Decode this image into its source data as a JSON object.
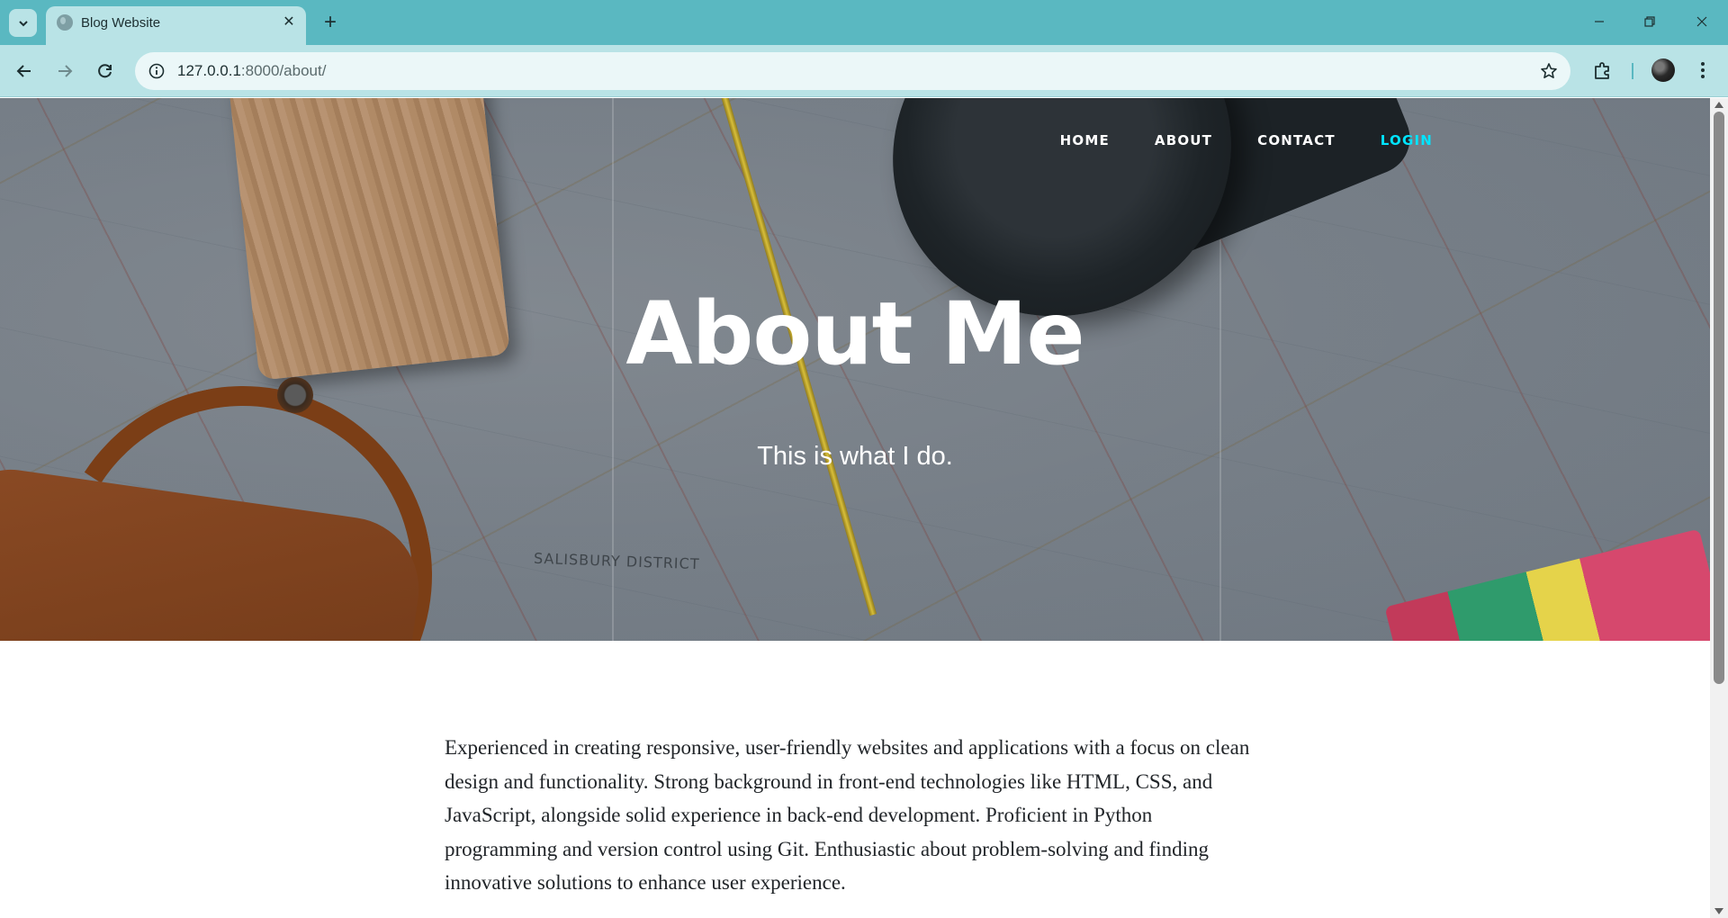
{
  "browser": {
    "tab_title": "Blog Website",
    "url_host": "127.0.0.1",
    "url_path": ":8000/about/"
  },
  "nav": {
    "items": [
      {
        "label": "HOME"
      },
      {
        "label": "ABOUT"
      },
      {
        "label": "CONTACT"
      },
      {
        "label": "LOGIN",
        "active": true
      }
    ]
  },
  "hero": {
    "title": "About Me",
    "subtitle": "This is what I do.",
    "map_label": "SALISBURY DISTRICT"
  },
  "content": {
    "paragraph": "Experienced in creating responsive, user-friendly websites and applications with a focus on clean design and functionality. Strong background in front-end technologies like HTML, CSS, and JavaScript, alongside solid experience in back-end development. Proficient in Python programming and version control using Git. Enthusiastic about problem-solving and finding innovative solutions to enhance user experience."
  },
  "colors": {
    "browser_frame": "#5ab8c1",
    "toolbar": "#b9e3e6",
    "active_nav": "#00e5ff",
    "body_text": "#212529"
  },
  "icons": {
    "tab_list": "chevron-down-icon",
    "favicon": "globe-icon",
    "tab_close": "close-icon",
    "new_tab": "plus-icon",
    "back": "arrow-left-icon",
    "forward": "arrow-right-icon",
    "reload": "reload-icon",
    "site_info": "info-icon",
    "bookmark": "star-icon",
    "extensions": "puzzle-icon",
    "profile": "avatar",
    "menu": "kebab-menu-icon"
  }
}
